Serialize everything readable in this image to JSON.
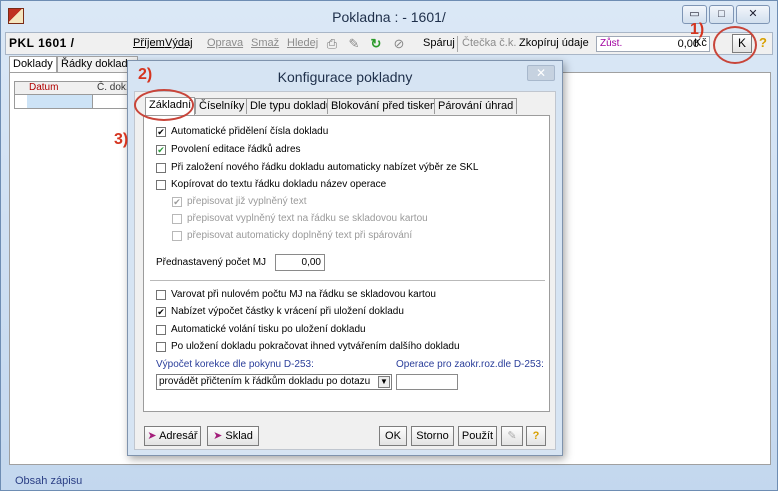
{
  "window": {
    "title": "Pokladna : - 1601/",
    "min": "▭",
    "max": "□",
    "close": "✕"
  },
  "toolbar": {
    "doc_id": "PKL 1601 /",
    "prijem": "Příjem",
    "vydaj": "Výdaj",
    "oprava": "Oprava",
    "smaz": "Smaž",
    "hledej": "Hledej",
    "sparuj": "Spáruj",
    "ctecka": "Čtečka č.k.",
    "kopiruj": "Zkopíruj údaje",
    "zust_label": "Zůst.",
    "zust_value": "0,00",
    "currency": "Kč",
    "k_button": "K",
    "help": "?"
  },
  "markers": {
    "m1": "1)",
    "m2": "2)",
    "m3": "3)"
  },
  "main_tabs": [
    "Doklady",
    "Řádky dokladu"
  ],
  "grid_headers": [
    "Datum",
    "Č. dok."
  ],
  "status_text": "Obsah zápisu",
  "dialog": {
    "title": "Konfigurace pokladny",
    "close": "✕",
    "tabs": [
      "Základní",
      "Číselníky",
      "Dle typu dokladu",
      "Blokování před tiskem",
      "Párování úhrad"
    ],
    "options": [
      {
        "label": "Automatické přidělení čísla dokladu",
        "checked": "✔"
      },
      {
        "label": "Povolení editace řádků adres",
        "checked": "✔"
      },
      {
        "label": "Při založení nového řádku dokladu automaticky nabízet výběr ze SKL",
        "checked": ""
      },
      {
        "label": "Kopírovat do textu řádku dokladu název operace",
        "checked": ""
      },
      {
        "label": "přepisovat již vyplněný text",
        "checked": "✔"
      },
      {
        "label": "přepisovat vyplněný text na řádku se skladovou kartou",
        "checked": ""
      },
      {
        "label": "přepisovat automaticky doplněný text při spárování",
        "checked": ""
      }
    ],
    "preset_label": "Přednastavený počet MJ",
    "preset_value": "0,00",
    "options2": [
      {
        "label": "Varovat při nulovém počtu MJ na řádku se skladovou kartou",
        "checked": ""
      },
      {
        "label": "Nabízet výpočet částky k vrácení při uložení dokladu",
        "checked": "✔"
      },
      {
        "label": "Automatické volání tisku po uložení dokladu",
        "checked": ""
      },
      {
        "label": "Po uložení dokladu pokračovat ihned vytvářením dalšího dokladu",
        "checked": ""
      }
    ],
    "korekce_label": "Výpočet korekce dle pokynu D-253:",
    "korekce_value": "provádět přičtením k řádkům dokladu po dotazu",
    "operace_label": "Operace pro zaokr.roz.dle D-253:",
    "operace_value": "",
    "buttons": {
      "adresar": "Adresář",
      "sklad": "Sklad",
      "ok": "OK",
      "storno": "Storno",
      "pouzit": "Použít",
      "help": "?"
    }
  }
}
